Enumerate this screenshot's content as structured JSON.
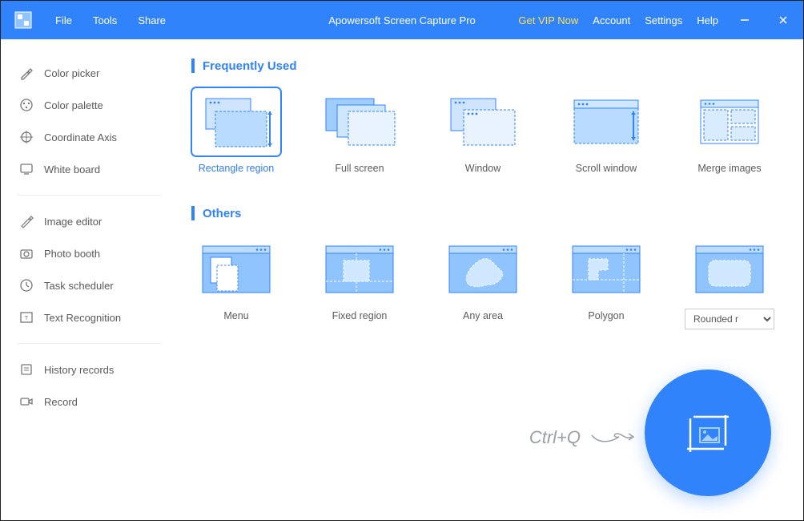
{
  "titlebar": {
    "menu": {
      "file": "File",
      "tools": "Tools",
      "share": "Share"
    },
    "appTitle": "Apowersoft Screen Capture Pro",
    "vip": "Get VIP Now",
    "account": "Account",
    "settings": "Settings",
    "help": "Help"
  },
  "sidebar": {
    "group1": {
      "colorPicker": "Color picker",
      "colorPalette": "Color palette",
      "coordinateAxis": "Coordinate Axis",
      "whiteBoard": "White board"
    },
    "group2": {
      "imageEditor": "Image editor",
      "photoBooth": "Photo booth",
      "taskScheduler": "Task scheduler",
      "textRecognition": "Text Recognition"
    },
    "group3": {
      "historyRecords": "History records",
      "record": "Record"
    }
  },
  "sections": {
    "frequently": "Frequently Used",
    "others": "Others"
  },
  "tiles": {
    "frequently": {
      "rectangle": "Rectangle region",
      "fullscreen": "Full screen",
      "window": "Window",
      "scroll": "Scroll window",
      "merge": "Merge images"
    },
    "others": {
      "menu": "Menu",
      "fixed": "Fixed region",
      "any": "Any area",
      "polygon": "Polygon",
      "roundedSelected": "Rounded r"
    }
  },
  "shortcutHint": "Ctrl+Q"
}
